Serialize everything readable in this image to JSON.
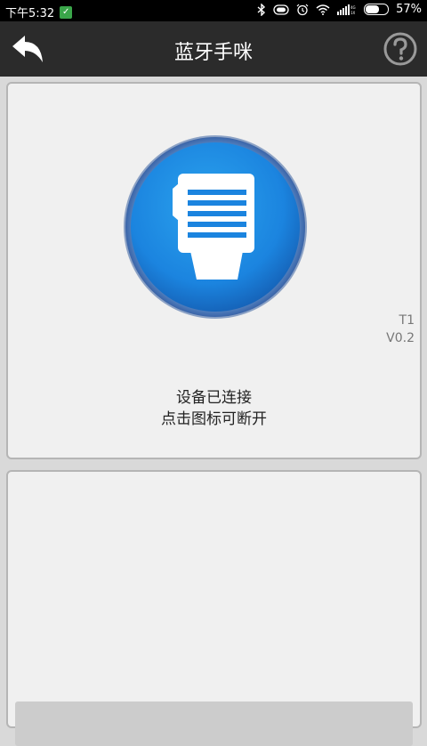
{
  "status_bar": {
    "time": "下午5:32",
    "battery_percent": "57%",
    "battery_level": 0.57
  },
  "app_bar": {
    "title": "蓝牙手咪",
    "back_icon": "back-arrow-icon",
    "help_icon": "help-circle-icon"
  },
  "device_panel": {
    "icon": "bluetooth-mic-device-icon",
    "model": "T1",
    "version": "V0.2",
    "status_line1": "设备已连接",
    "status_line2": "点击图标可断开"
  },
  "colors": {
    "accent_blue": "#1f7ad8",
    "app_bar_bg": "#2b2b2b",
    "panel_bg": "#f0f0f0"
  }
}
